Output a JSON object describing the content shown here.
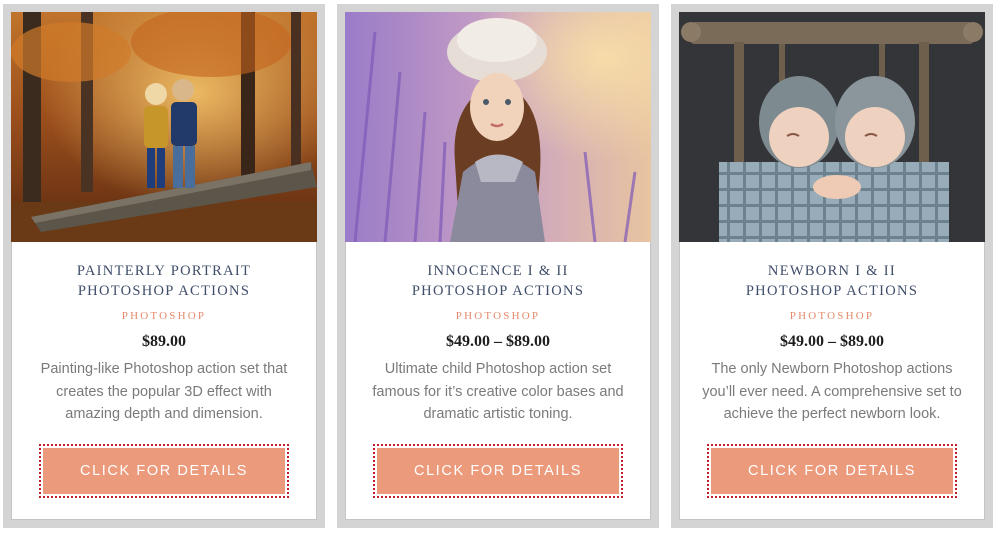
{
  "products": [
    {
      "title_line1": "Painterly Portrait",
      "title_line2": "Photoshop Actions",
      "category": "Photoshop",
      "price": "$89.00",
      "description": "Painting-like Photoshop action set that creates the popular 3D effect with amazing depth and dimension.",
      "button_label": "Click for details",
      "photo": "autumn-children-on-log"
    },
    {
      "title_line1": "Innocence I & II",
      "title_line2": "Photoshop Actions",
      "category": "Photoshop",
      "price": "$49.00 – $89.00",
      "description": "Ultimate child Photoshop action set famous for it’s creative color bases and dramatic artistic toning.",
      "button_label": "Click for details",
      "photo": "girl-in-lavender-field"
    },
    {
      "title_line1": "Newborn I & II",
      "title_line2": "Photoshop Actions",
      "category": "Photoshop",
      "price": "$49.00 – $89.00",
      "description": "The only Newborn Photoshop actions you’ll ever need. A comprehensive set to achieve the perfect newborn look.",
      "button_label": "Click for details",
      "photo": "newborn-twins-in-bed"
    }
  ],
  "colors": {
    "card_border": "#d4d4d4",
    "title": "#3f4d6a",
    "category": "#e48a6a",
    "button": "#ec9a7c",
    "button_border": "#c01d2a"
  }
}
